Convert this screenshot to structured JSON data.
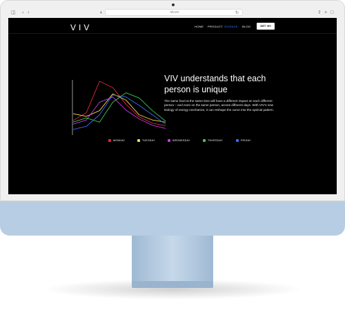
{
  "browser": {
    "address": "viv.co",
    "icons": {
      "sidebar": "sidebar-icon",
      "back": "chevron-left-icon",
      "forward": "chevron-right-icon",
      "shield": "shield-icon",
      "reload": "reload-icon",
      "share": "share-icon",
      "new_tab": "plus-icon",
      "tabs": "tabs-icon"
    }
  },
  "site": {
    "logo": "VIV",
    "nav": [
      {
        "label": "HOME",
        "active": false
      },
      {
        "label": "PRODUCT",
        "active": false
      },
      {
        "label": "SCIENCE",
        "active": true
      },
      {
        "label": "BLOG",
        "active": false
      }
    ],
    "cta": "GET VIV"
  },
  "hero": {
    "headline": "VIV understands that each person is unique",
    "body": "The same food at the same time will have a different impact on each different person – and even on the same person, across different days. With VIV's new biology of energy mechanics, it can reshape the curve into the optimal pattern."
  },
  "legend": [
    {
      "label": "MONDAY",
      "color": "#e0283c"
    },
    {
      "label": "TUESDAY",
      "color": "#f2e04a"
    },
    {
      "label": "WEDNESDAY",
      "color": "#c83adf"
    },
    {
      "label": "THURSDAY",
      "color": "#3fc94e"
    },
    {
      "label": "FRIDAY",
      "color": "#3c6cf0"
    }
  ],
  "chart_data": {
    "type": "line",
    "x": [
      0,
      1,
      2,
      3,
      4,
      5,
      6,
      7
    ],
    "xlabel": "",
    "ylabel": "",
    "ylim": [
      0,
      10
    ],
    "series": [
      {
        "name": "MONDAY",
        "color": "#e0283c",
        "values": [
          2.5,
          4.0,
          10.0,
          8.8,
          5.6,
          3.2,
          2.0,
          1.5
        ]
      },
      {
        "name": "TUESDAY",
        "color": "#f2e04a",
        "values": [
          3.8,
          3.3,
          4.4,
          7.6,
          6.4,
          3.6,
          2.6,
          2.2
        ]
      },
      {
        "name": "WEDNESDAY",
        "color": "#c83adf",
        "values": [
          1.8,
          2.6,
          6.0,
          7.0,
          4.5,
          2.8,
          1.6,
          1.0
        ]
      },
      {
        "name": "THURSDAY",
        "color": "#3fc94e",
        "values": [
          2.2,
          3.0,
          2.2,
          6.0,
          7.8,
          6.8,
          4.4,
          2.4
        ]
      },
      {
        "name": "FRIDAY",
        "color": "#3c6cf0",
        "values": [
          0.8,
          1.4,
          3.6,
          7.4,
          7.0,
          5.4,
          3.6,
          1.8
        ]
      }
    ]
  }
}
